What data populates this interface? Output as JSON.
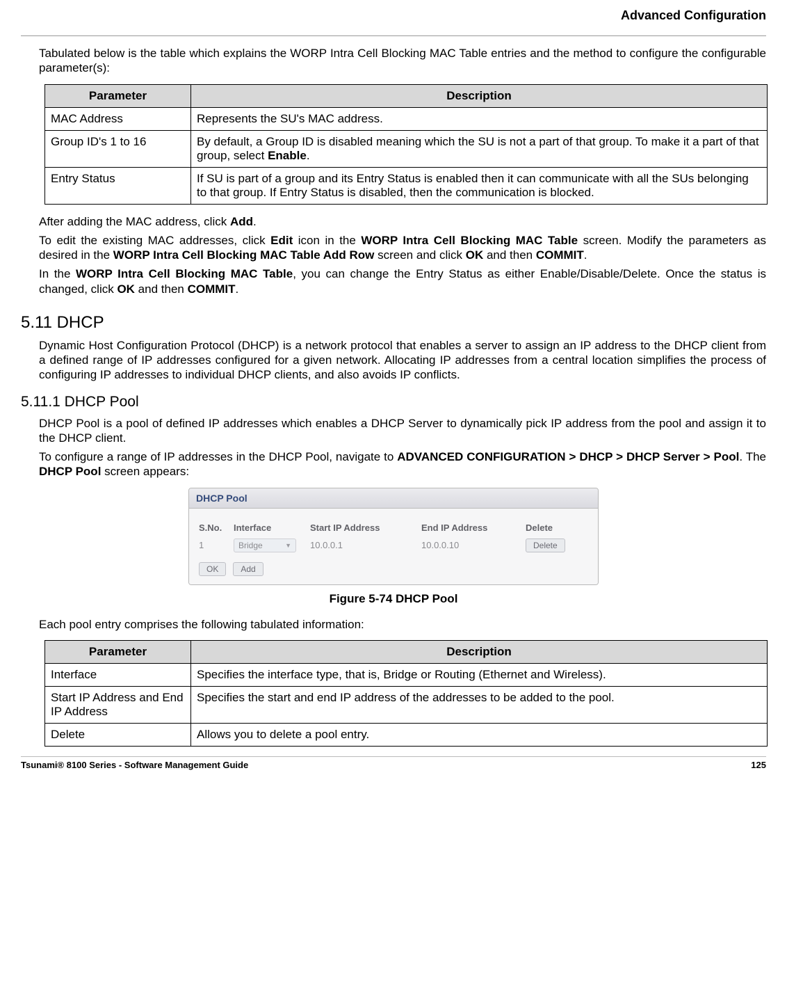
{
  "header": {
    "title": "Advanced Configuration"
  },
  "intro1": "Tabulated below is the table which explains the WORP Intra Cell Blocking MAC Table entries and the method to configure the configurable parameter(s):",
  "tbl1": {
    "head": {
      "c1": "Parameter",
      "c2": "Description"
    },
    "rows": [
      {
        "p": "MAC Address",
        "d_pre": "Represents the SU's MAC address.",
        "d_bold": "",
        "d_post": ""
      },
      {
        "p": "Group ID's 1 to 16",
        "d_pre": "By default, a Group ID is disabled meaning which the SU is not a part of that group. To make it a part of that group, select ",
        "d_bold": "Enable",
        "d_post": "."
      },
      {
        "p": "Entry Status",
        "d_pre": "If SU is part of a group and its Entry Status is enabled then it can communicate with all the SUs belonging to that group. If Entry Status is disabled, then the communication is blocked.",
        "d_bold": "",
        "d_post": ""
      }
    ]
  },
  "para_after_add": {
    "pre": "After adding the MAC address, click ",
    "b1": "Add",
    "post": "."
  },
  "para_edit": {
    "s1": "To edit the existing MAC addresses, click ",
    "b1": "Edit",
    "s2": " icon in the ",
    "b2": "WORP Intra Cell Blocking MAC Table",
    "s3": " screen. Modify the parameters as desired in the ",
    "b3": "WORP Intra Cell Blocking MAC Table Add Row",
    "s4": " screen and click ",
    "b4": "OK",
    "s5": " and then ",
    "b5": "COMMIT",
    "s6": "."
  },
  "para_status": {
    "s1": "In the ",
    "b1": "WORP Intra Cell Blocking MAC Table",
    "s2": ", you can change the Entry Status as either Enable/Disable/Delete. Once the status is changed, click ",
    "b2": "OK",
    "s3": " and then ",
    "b3": "COMMIT",
    "s4": "."
  },
  "sec_dhcp": {
    "num_title": "5.11 DHCP"
  },
  "dhcp_intro": "Dynamic Host Configuration Protocol (DHCP) is a network protocol that enables a server to assign an IP address to the DHCP client from a defined range of IP addresses configured for a given network. Allocating IP addresses from a central location simplifies the process of configuring IP addresses to individual DHCP clients, and also avoids IP conflicts.",
  "sec_pool": {
    "num_title": "5.11.1 DHCP Pool"
  },
  "pool_intro": "DHCP Pool is a pool of defined IP addresses which enables a DHCP Server to dynamically pick IP address from the pool and assign it to the DHCP client.",
  "pool_nav": {
    "s1": "To configure a range of IP addresses in the DHCP Pool, navigate to ",
    "b1": "ADVANCED CONFIGURATION > DHCP > DHCP Server > Pool",
    "s2": ". The ",
    "b2": "DHCP Pool",
    "s3": " screen appears:"
  },
  "screenshot": {
    "title": "DHCP Pool",
    "head": {
      "c1": "S.No.",
      "c2": "Interface",
      "c3": "Start IP Address",
      "c4": "End IP Address",
      "c5": "Delete"
    },
    "row": {
      "no": "1",
      "iface": "Bridge",
      "start": "10.0.0.1",
      "end": "10.0.0.10",
      "del": "Delete"
    },
    "btn_ok": "OK",
    "btn_add": "Add"
  },
  "fig_caption": "Figure 5-74 DHCP Pool",
  "pool_follow": "Each pool entry comprises the following tabulated information:",
  "tbl2": {
    "head": {
      "c1": "Parameter",
      "c2": "Description"
    },
    "rows": [
      {
        "p": "Interface",
        "d": "Specifies the interface type, that is, Bridge or Routing (Ethernet and Wireless)."
      },
      {
        "p": "Start IP Address and End IP Address",
        "d": "Specifies the start and end IP address of the addresses to be added to the pool."
      },
      {
        "p": "Delete",
        "d": "Allows you to delete a pool entry."
      }
    ]
  },
  "footer": {
    "left": "Tsunami® 8100 Series - Software Management Guide",
    "right": "125"
  }
}
